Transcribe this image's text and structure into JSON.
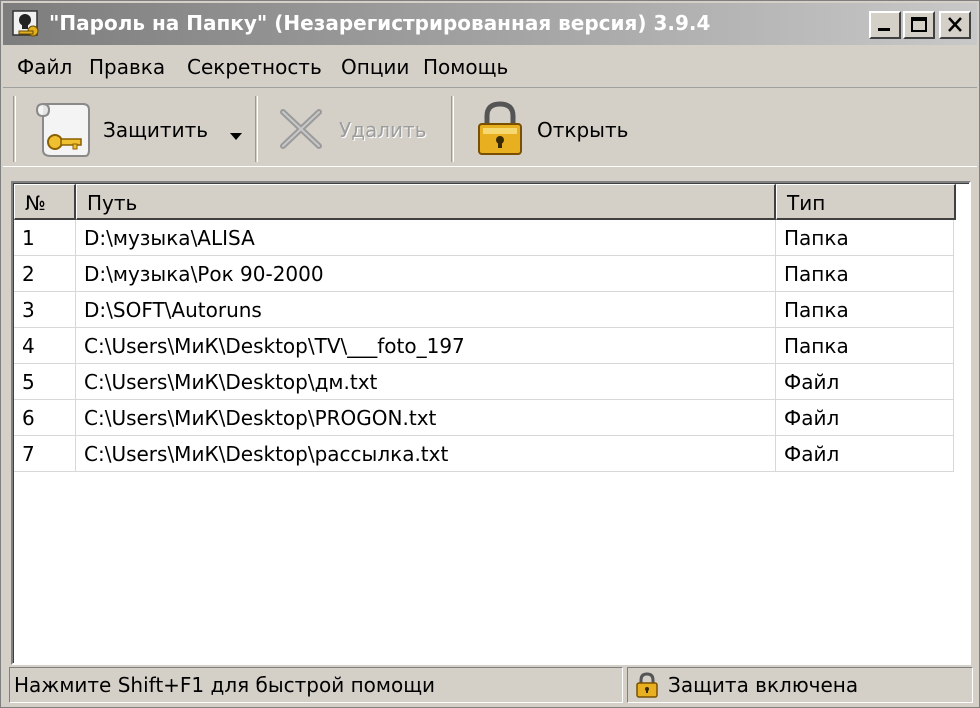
{
  "window": {
    "title": "\"Пароль на Папку\" (Незарегистрированная версия) 3.9.4"
  },
  "menu": [
    "Файл",
    "Правка",
    "Секретность",
    "Опции",
    "Помощь"
  ],
  "toolbar": {
    "protect_label": "Защитить",
    "delete_label": "Удалить",
    "open_label": "Открыть"
  },
  "table": {
    "columns": [
      "№",
      "Путь",
      "Тип"
    ],
    "rows": [
      {
        "num": "1",
        "path": "D:\\музыка\\ALISA",
        "type": "Папка"
      },
      {
        "num": "2",
        "path": "D:\\музыка\\Рок 90-2000",
        "type": "Папка"
      },
      {
        "num": "3",
        "path": "D:\\SOFT\\Autoruns",
        "type": "Папка"
      },
      {
        "num": "4",
        "path": "C:\\Users\\МиК\\Desktop\\TV\\___foto_197",
        "type": "Папка"
      },
      {
        "num": "5",
        "path": "C:\\Users\\МиК\\Desktop\\дм.txt",
        "type": "Файл"
      },
      {
        "num": "6",
        "path": "C:\\Users\\МиК\\Desktop\\PROGON.txt",
        "type": "Файл"
      },
      {
        "num": "7",
        "path": "C:\\Users\\МиК\\Desktop\\рассылка.txt",
        "type": "Файл"
      }
    ]
  },
  "status": {
    "help_text": "Нажмите Shift+F1 для быстрой помощи",
    "protection_text": "Защита включена"
  }
}
